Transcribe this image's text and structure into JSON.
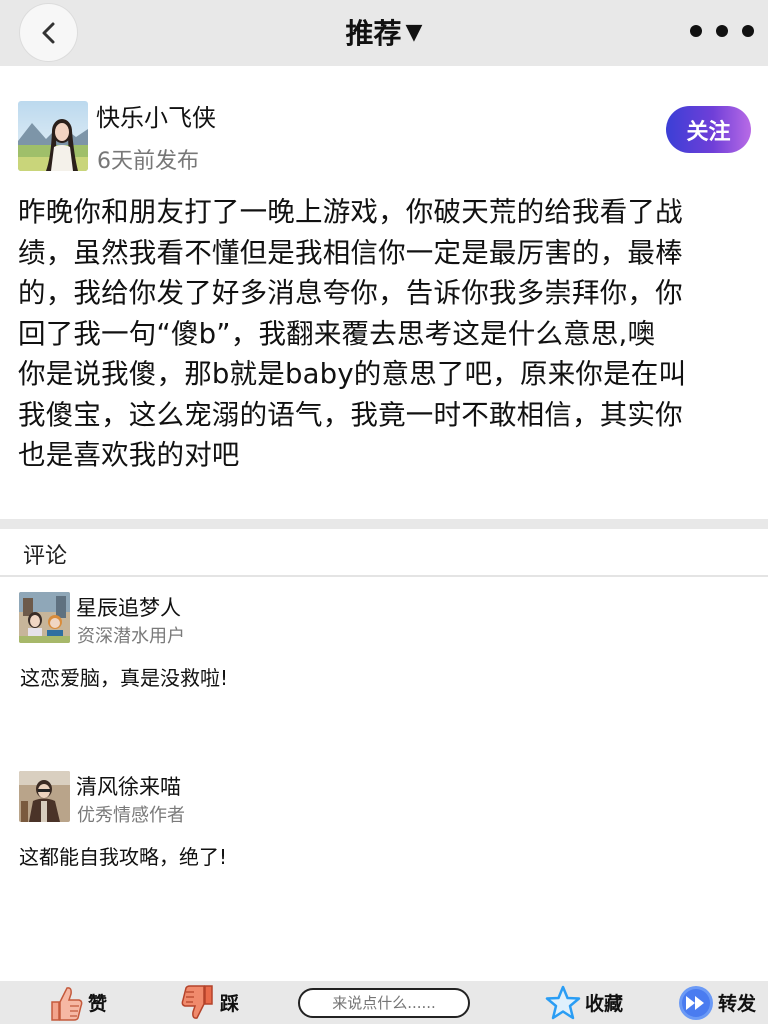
{
  "header": {
    "title": "推荐",
    "caret": "▼"
  },
  "post": {
    "author": "快乐小飞侠",
    "time": "6天前发布",
    "follow_label": "关注",
    "lines": [
      "昨晚你和朋友打了一晚上游戏，你破天荒的给我看了战",
      "绩，虽然我看不懂但是我相信你一定是最厉害的，最棒",
      "的，我给你发了好多消息夸你，告诉你我多崇拜你，你",
      "回了我一句“傻b”，我翻来覆去思考这是什么意思,噢",
      "你是说我傻，那b就是baby的意思了吧，原来你是在叫",
      "我傻宝，这么宠溺的语气，我竟一时不敢相信，其实你",
      "也是喜欢我的对吧"
    ]
  },
  "comments_section": {
    "heading": "评论",
    "items": [
      {
        "name": "星辰追梦人",
        "badge": "资深潜水用户",
        "text": "这恋爱脑，真是没救啦!"
      },
      {
        "name": "清风徐来喵",
        "badge": "优秀情感作者",
        "text": "这都能自我攻略，绝了!"
      }
    ]
  },
  "bottom_bar": {
    "like_label": "赞",
    "dislike_label": "踩",
    "comment_placeholder": "来说点什么......",
    "favorite_label": "收藏",
    "share_label": "转发"
  },
  "colors": {
    "header_bg": "#e8e8e8",
    "follow_gradient_start": "#3b3fd6",
    "follow_gradient_end": "#b86be6",
    "like_icon": "#f2a48c",
    "dislike_icon": "#e86a4a",
    "favorite_icon": "#2a9df4",
    "share_icon": "#4a7cf0"
  },
  "icons": [
    "chevron-left-icon",
    "more-dots-icon",
    "thumbs-up-icon",
    "thumbs-down-icon",
    "star-icon",
    "fast-forward-icon"
  ]
}
